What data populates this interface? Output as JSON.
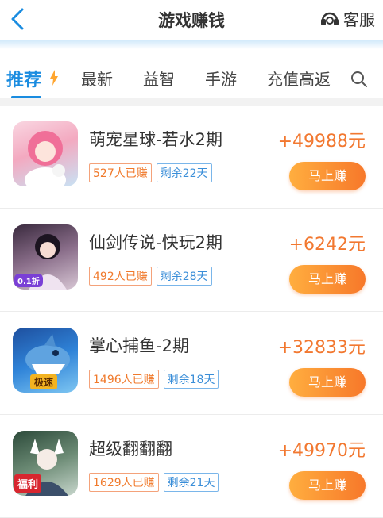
{
  "header": {
    "title": "游戏赚钱",
    "service_label": "客服"
  },
  "tabs": [
    {
      "label": "推荐",
      "active": true
    },
    {
      "label": "最新",
      "active": false
    },
    {
      "label": "益智",
      "active": false
    },
    {
      "label": "手游",
      "active": false
    },
    {
      "label": "充值高返",
      "active": false
    }
  ],
  "colors": {
    "accent": "#1a8ce0",
    "reward": "#f27830",
    "button_start": "#ffae3f",
    "button_end": "#f7782a"
  },
  "games": [
    {
      "name": "萌宠星球-若水2期",
      "players": "527人已赚",
      "days_left": "剩余22天",
      "reward": "+49988元",
      "button": "马上赚",
      "badge": ""
    },
    {
      "name": "仙剑传说-快玩2期",
      "players": "492人已赚",
      "days_left": "剩余28天",
      "reward": "+6242元",
      "button": "马上赚",
      "badge": "0.1折"
    },
    {
      "name": "掌心捕鱼-2期",
      "players": "1496人已赚",
      "days_left": "剩余18天",
      "reward": "+32833元",
      "button": "马上赚",
      "badge": "极速"
    },
    {
      "name": "超级翻翻翻",
      "players": "1629人已赚",
      "days_left": "剩余21天",
      "reward": "+49970元",
      "button": "马上赚",
      "badge": "福利"
    }
  ]
}
